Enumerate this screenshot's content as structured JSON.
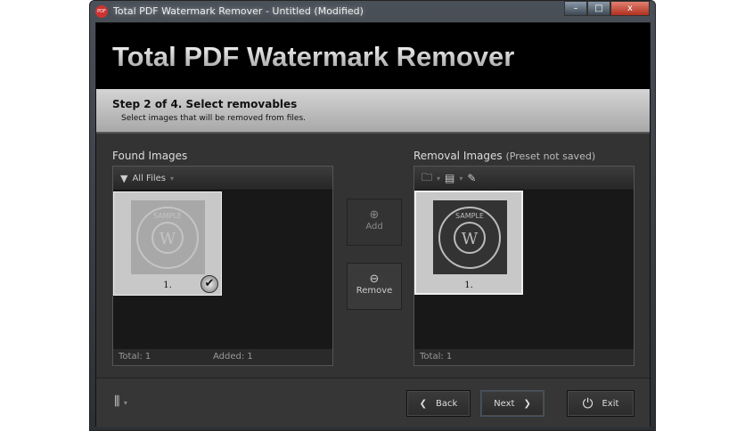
{
  "window": {
    "title": "Total PDF Watermark Remover - Untitled (Modified)",
    "icon_text": "PDF",
    "minimize": "–",
    "maximize": "□",
    "close": "x"
  },
  "header": {
    "title": "Total PDF Watermark Remover"
  },
  "step": {
    "title": "Step 2 of 4. Select removables",
    "subtitle": "Select images that will be removed from files."
  },
  "found": {
    "label": "Found Images",
    "filter": "All Files",
    "items": [
      {
        "num": "1.",
        "checked": true
      }
    ],
    "total": "Total: 1",
    "added": "Added: 1"
  },
  "removal": {
    "label": "Removal Images",
    "note": "(Preset not saved)",
    "items": [
      {
        "num": "1."
      }
    ],
    "total": "Total: 1"
  },
  "actions": {
    "add": "Add",
    "remove": "Remove"
  },
  "stamp": {
    "top": "SAMPLE",
    "bottom": "SAMPLE",
    "center": "W"
  },
  "nav": {
    "back": "Back",
    "next": "Next",
    "exit": "Exit"
  }
}
